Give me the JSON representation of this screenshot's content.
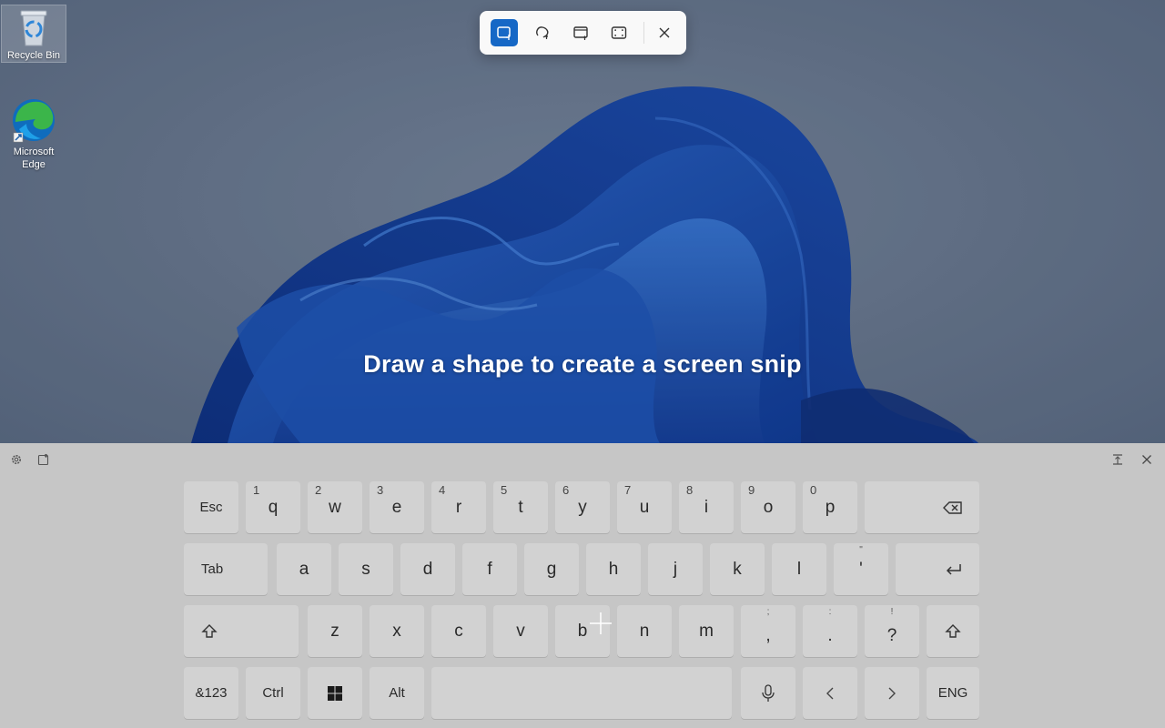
{
  "desktop": {
    "icons": [
      {
        "label": "Recycle Bin",
        "icon": "recycle-bin-icon"
      },
      {
        "label_line1": "Microsoft",
        "label_line2": "Edge",
        "icon": "edge-icon"
      }
    ]
  },
  "snip_toolbar": {
    "modes": [
      {
        "id": "rectangle",
        "icon": "rectangle-snip-icon",
        "active": true
      },
      {
        "id": "freeform",
        "icon": "freeform-snip-icon",
        "active": false
      },
      {
        "id": "window",
        "icon": "window-snip-icon",
        "active": false
      },
      {
        "id": "fullscreen",
        "icon": "fullscreen-snip-icon",
        "active": false
      }
    ],
    "close_icon": "close-icon",
    "accent": "#1668c6"
  },
  "hint": "Draw a shape to create a screen snip",
  "keyboard": {
    "tools_left": [
      "gear-icon",
      "emoji-icon"
    ],
    "tools_right": [
      "dock-icon",
      "close-icon"
    ],
    "row1": {
      "esc": "Esc",
      "keys": [
        {
          "main": "q",
          "sec": "1"
        },
        {
          "main": "w",
          "sec": "2"
        },
        {
          "main": "e",
          "sec": "3"
        },
        {
          "main": "r",
          "sec": "4"
        },
        {
          "main": "t",
          "sec": "5"
        },
        {
          "main": "y",
          "sec": "6"
        },
        {
          "main": "u",
          "sec": "7"
        },
        {
          "main": "i",
          "sec": "8"
        },
        {
          "main": "o",
          "sec": "9"
        },
        {
          "main": "p",
          "sec": "0"
        }
      ],
      "backspace_icon": "backspace-icon"
    },
    "row2": {
      "tab": "Tab",
      "keys": [
        {
          "main": "a"
        },
        {
          "main": "s"
        },
        {
          "main": "d"
        },
        {
          "main": "f"
        },
        {
          "main": "g"
        },
        {
          "main": "h"
        },
        {
          "main": "j"
        },
        {
          "main": "k"
        },
        {
          "main": "l"
        },
        {
          "main": "'",
          "sec": "\""
        }
      ],
      "enter_icon": "enter-icon"
    },
    "row3": {
      "shift_icon": "shift-icon",
      "keys": [
        {
          "main": "z"
        },
        {
          "main": "x"
        },
        {
          "main": "c"
        },
        {
          "main": "v"
        },
        {
          "main": "b"
        },
        {
          "main": "n"
        },
        {
          "main": "m"
        },
        {
          "main": ",",
          "sec": ";"
        },
        {
          "main": ".",
          "sec": ":"
        },
        {
          "main": "?",
          "sec": "!"
        }
      ]
    },
    "row4": {
      "symbols": "&123",
      "ctrl": "Ctrl",
      "windows_icon": "windows-icon",
      "alt": "Alt",
      "mic_icon": "microphone-icon",
      "left_icon": "chevron-left-icon",
      "right_icon": "chevron-right-icon",
      "lang": "ENG"
    }
  }
}
